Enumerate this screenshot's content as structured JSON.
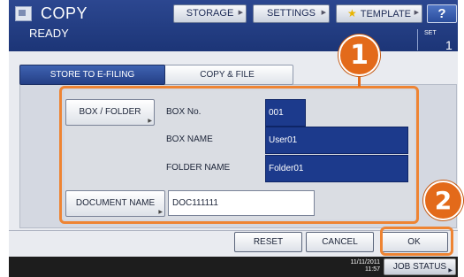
{
  "header": {
    "title": "COPY",
    "status": "READY",
    "buttons": {
      "storage": "STORAGE",
      "settings": "SETTINGS",
      "template": "TEMPLATE",
      "help": "?"
    },
    "set_label": "SET",
    "set_value": "1"
  },
  "tabs": [
    {
      "label": "STORE TO E-FILING",
      "active": true
    },
    {
      "label": "COPY & FILE",
      "active": false
    }
  ],
  "form": {
    "box_folder_button": "BOX / FOLDER",
    "box_no_label": "BOX No.",
    "box_no_value": "001",
    "box_name_label": "BOX NAME",
    "box_name_value": "User01",
    "folder_name_label": "FOLDER NAME",
    "folder_name_value": "Folder01",
    "document_name_button": "DOCUMENT NAME",
    "document_name_value": "DOC111111"
  },
  "footer": {
    "reset": "RESET",
    "cancel": "CANCEL",
    "ok": "OK"
  },
  "statusbar": {
    "date": "11/11/2011",
    "time": "11:57",
    "job_status": "JOB STATUS"
  },
  "callouts": {
    "step1": "1",
    "step2": "2"
  },
  "colors": {
    "header": "#1c3577",
    "accent": "#ee8433",
    "callout": "#e36a1a",
    "field": "#1c3a8c"
  }
}
